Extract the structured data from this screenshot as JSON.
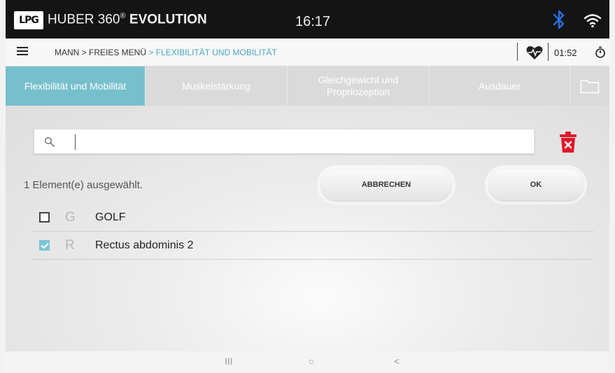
{
  "header": {
    "logo": "LPG",
    "title_light": "HUBER 360",
    "title_reg": "®",
    "title_bold": "EVOLUTION",
    "time": "16:17",
    "icons": [
      "bluetooth-icon",
      "wifi-icon"
    ]
  },
  "breadcrumb": {
    "path": "MANN > FREIES MENÜ",
    "separator": ">",
    "current": "FLEXIBILITÄT UND MOBILITÄT",
    "timer": "01:52",
    "icons": [
      "menu-icon",
      "heart-rate-icon",
      "stopwatch-icon"
    ]
  },
  "tabs": [
    {
      "label": "Flexibilität und Mobilität",
      "active": true
    },
    {
      "label": "Muskelstärkung",
      "active": false
    },
    {
      "label": "Gleichgewicht und Propriozeption",
      "active": false
    },
    {
      "label": "Ausdauer",
      "active": false
    }
  ],
  "search": {
    "value": "",
    "placeholder": ""
  },
  "selection": {
    "status": "1 Element(e) ausgewählt.",
    "cancel_label": "ABBRECHEN",
    "ok_label": "OK"
  },
  "items": [
    {
      "letter": "G",
      "name": "GOLF",
      "checked": false
    },
    {
      "letter": "R",
      "name": "Rectus abdominis 2",
      "checked": true
    }
  ],
  "navbar": {
    "recent": "III",
    "home": "○",
    "back": "<"
  },
  "colors": {
    "accent": "#76bfcc",
    "delete": "#e0182d",
    "bluetooth": "#2a6fe0"
  }
}
